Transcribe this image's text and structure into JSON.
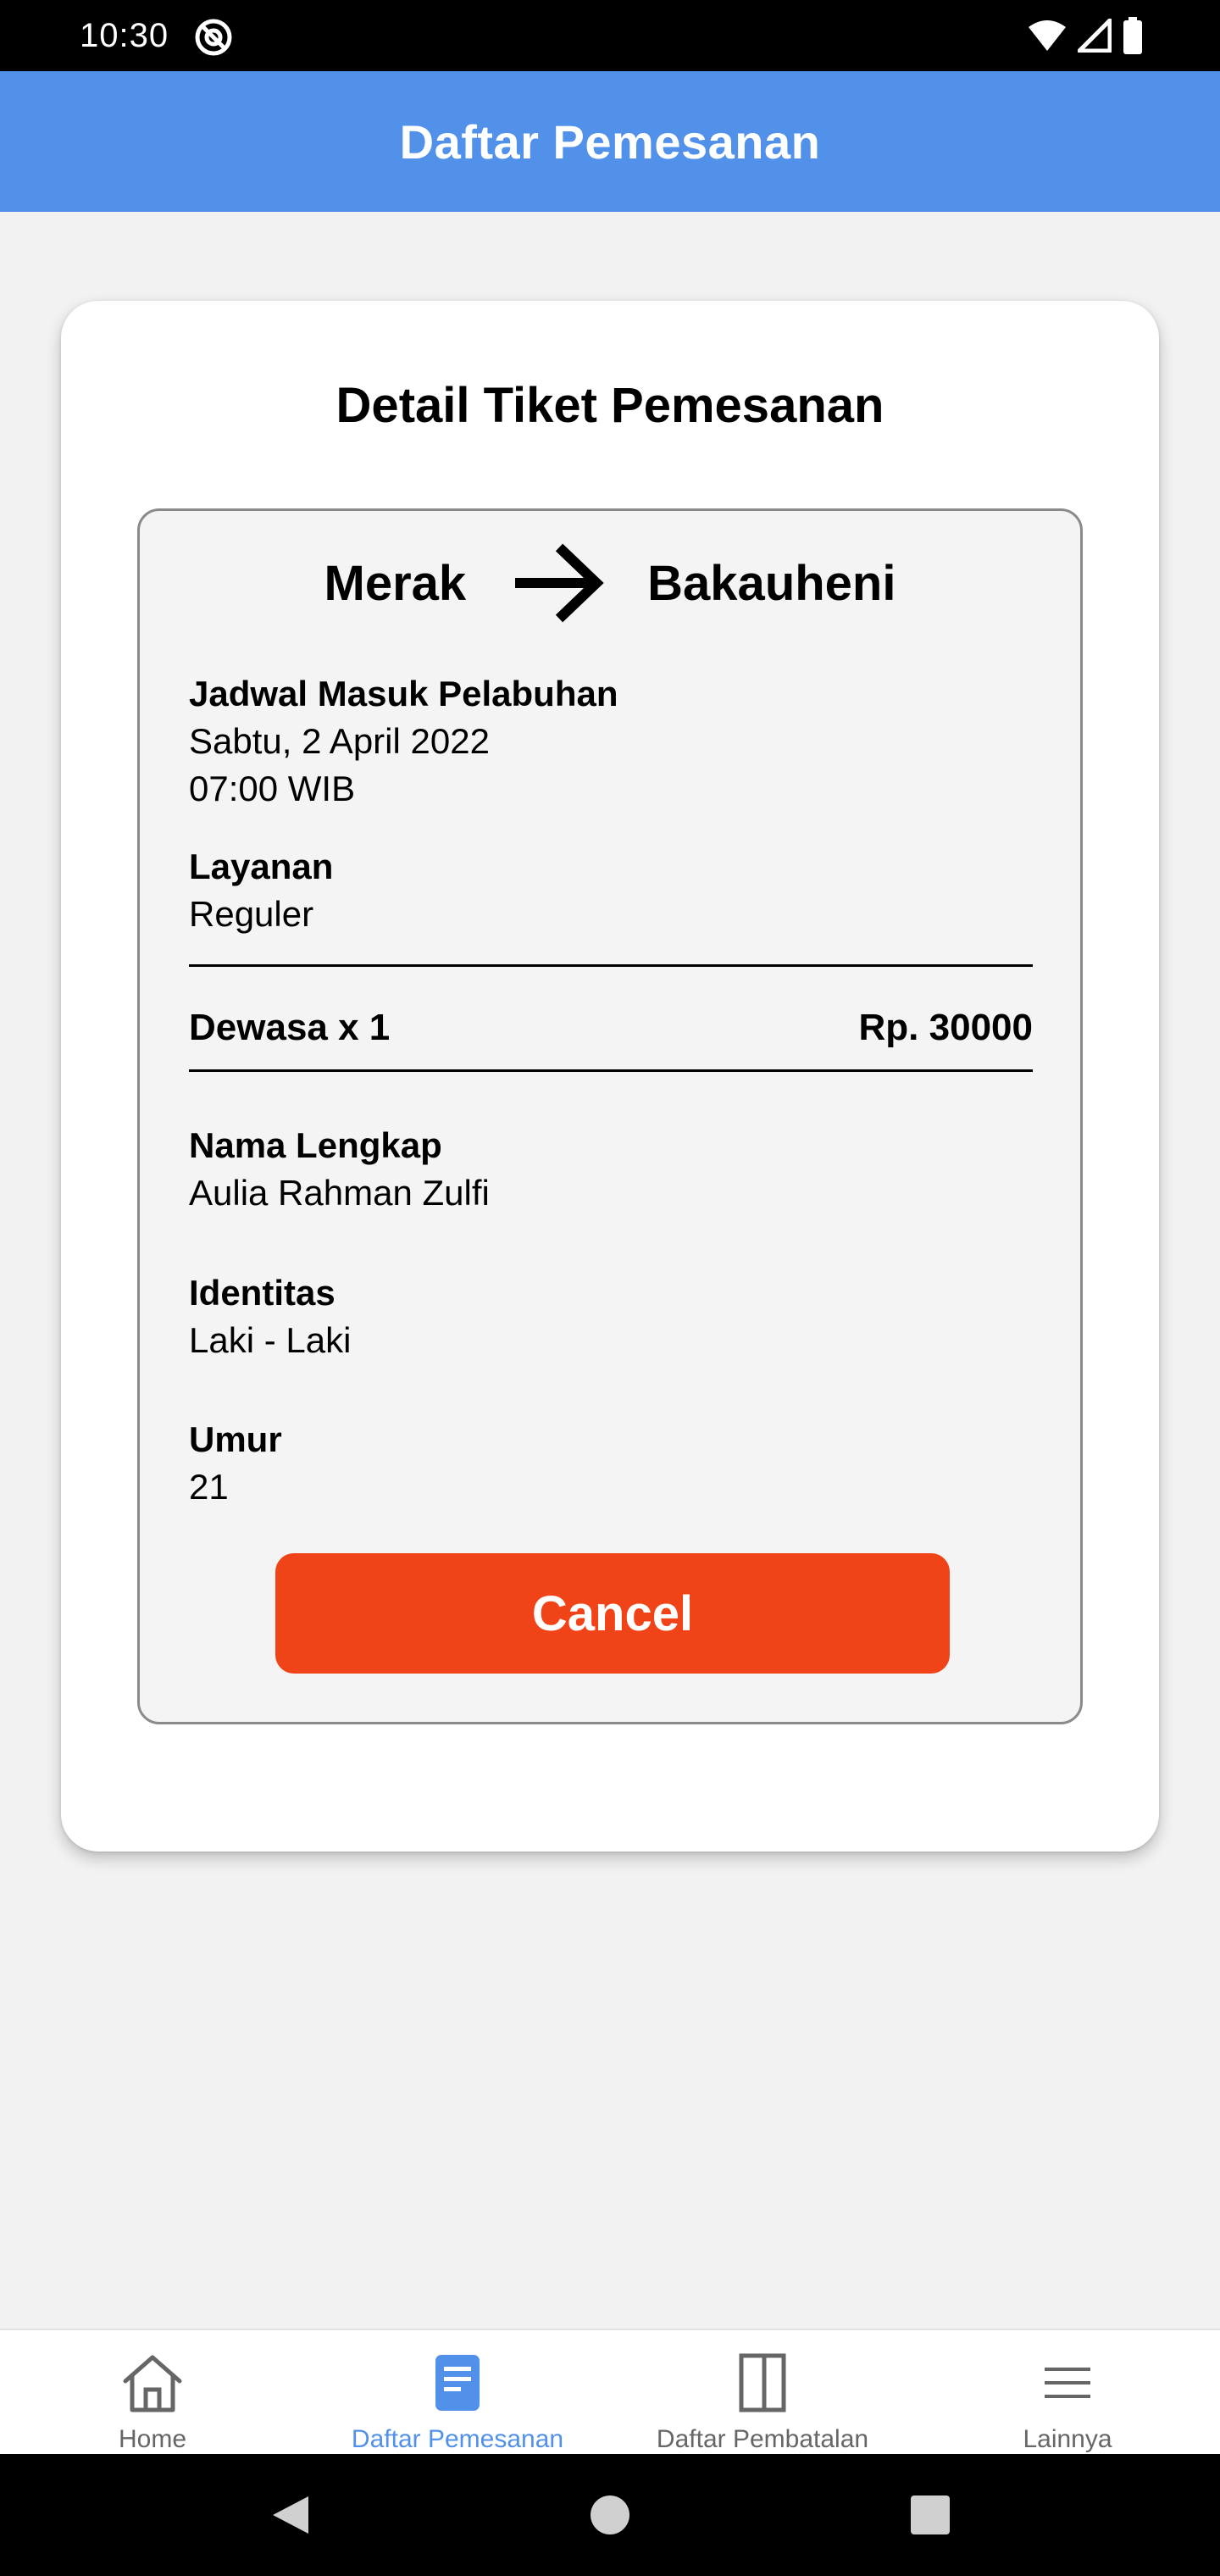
{
  "status_bar": {
    "time": "10:30",
    "icons": [
      "at-sign-icon",
      "wifi-icon",
      "signal-icon",
      "battery-icon"
    ]
  },
  "app_bar": {
    "title": "Daftar Pemesanan",
    "color": "#5291ea"
  },
  "card": {
    "title": "Detail Tiket Pemesanan"
  },
  "ticket": {
    "origin": "Merak",
    "destination": "Bakauheni",
    "schedule_label": "Jadwal Masuk Pelabuhan",
    "schedule_date": "Sabtu, 2 April 2022",
    "schedule_time": "07:00 WIB",
    "service_label": "Layanan",
    "service_value": "Reguler",
    "passenger_type": "Dewasa x 1",
    "price": "Rp. 30000",
    "name_label": "Nama Lengkap",
    "name_value": "Aulia Rahman Zulfi",
    "identity_label": "Identitas",
    "identity_value": "Laki - Laki",
    "age_label": "Umur",
    "age_value": "21"
  },
  "cancel_button": {
    "label": "Cancel",
    "color": "#f04418"
  },
  "bottom_nav": {
    "items": [
      {
        "label": "Home",
        "icon": "home-icon",
        "active": false
      },
      {
        "label": "Daftar Pemesanan",
        "icon": "document-icon",
        "active": true
      },
      {
        "label": "Daftar Pembatalan",
        "icon": "book-icon",
        "active": false
      },
      {
        "label": "Lainnya",
        "icon": "menu-icon",
        "active": false
      }
    ]
  },
  "system_nav": {
    "icons": [
      "back-icon",
      "home-circle-icon",
      "recents-icon"
    ]
  }
}
